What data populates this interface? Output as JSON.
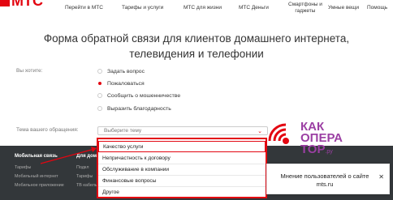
{
  "header": {
    "logo_text": "МТС",
    "nav": [
      {
        "label": "Перейти в МТС"
      },
      {
        "label": "Тарифы и услуги"
      },
      {
        "label": "МТС для жизни"
      },
      {
        "label": "МТС Деньги"
      },
      {
        "label": "Смартфоны и",
        "label2": "гаджеты"
      },
      {
        "label": "Умные вещи"
      },
      {
        "label": "Помощь"
      }
    ]
  },
  "main": {
    "title": "Форма обратной связи для клиентов домашнего интернета, телевидения и телефонии",
    "question_label": "Вы хотите:",
    "options": [
      {
        "label": "Задать вопрос",
        "checked": false
      },
      {
        "label": "Пожаловаться",
        "checked": true
      },
      {
        "label": "Сообщить о мошенничестве",
        "checked": false
      },
      {
        "label": "Выразить благодарность",
        "checked": false
      }
    ],
    "topic_label": "Тема вашего обращения:",
    "topic_placeholder": "Выберите тему",
    "topic_options": [
      "Качество услуги",
      "Непричастность к договору",
      "Обслуживание в компании",
      "Финансовые вопросы",
      "Другое"
    ]
  },
  "footer": {
    "col1_head": "Мобильная связь",
    "col1_items": [
      "Тарифы",
      "Мобильный интернет",
      "Мобильное приложение"
    ],
    "col2_head": "Для дома",
    "col2_items": [
      "Подкл",
      "Тарифы",
      "ТВ кабель"
    ]
  },
  "watermark": {
    "line1": "КАК",
    "line2": "ОПЕРА",
    "line3": "ТОР",
    "suffix": ".ру"
  },
  "tooltip": {
    "text": "Мнение пользователей о сайте mts.ru",
    "close": "✕"
  },
  "colors": {
    "accent": "#e30611",
    "footer_bg": "#33373a",
    "watermark": "#9b3fa3"
  }
}
